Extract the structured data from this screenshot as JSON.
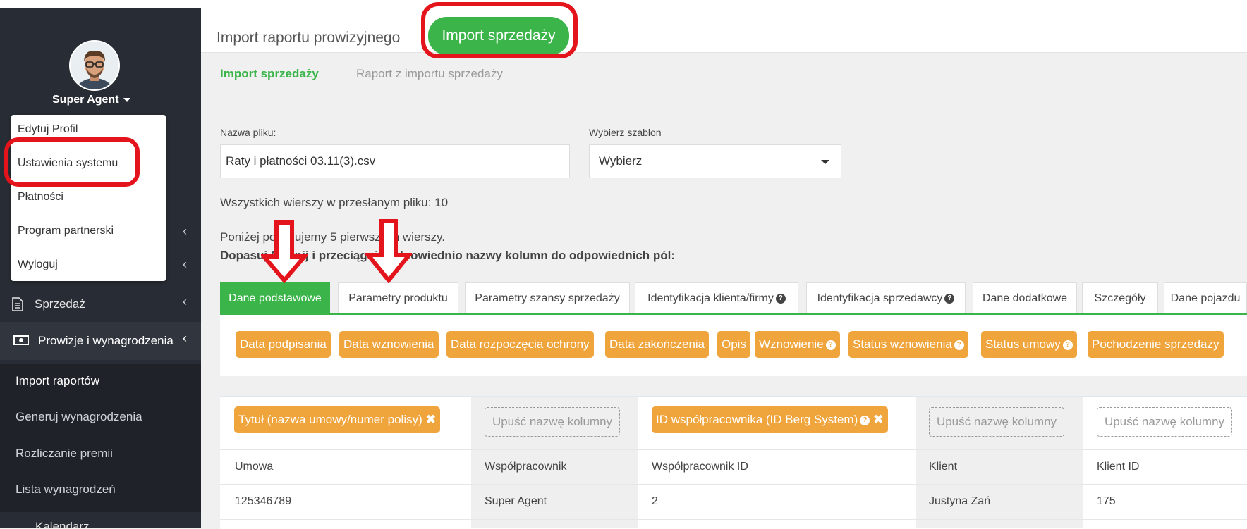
{
  "sidebar": {
    "user": {
      "name": "Super Agent"
    },
    "dropdown": [
      "Edytuj Profil",
      "Ustawienia systemu",
      "Płatności",
      "Program partnerski",
      "Wyloguj"
    ],
    "items": {
      "sales": "Sprzedaż",
      "commissions": "Prowizje i wynagrodzenia"
    },
    "submenu": [
      "Import raportów",
      "Generuj wynagrodzenia",
      "Rozliczanie premii",
      "Lista wynagrodzeń"
    ],
    "cut_item": "Kalendarz"
  },
  "topbar": {
    "tabs": [
      "Import raportu prowizyjnego",
      "Import sprzedaży"
    ]
  },
  "subtabs": [
    "Import sprzedaży",
    "Raport z importu sprzedaży"
  ],
  "form": {
    "file_label": "Nazwa pliku:",
    "file_value": "Raty i płatności 03.11(3).csv",
    "template_label": "Wybierz szablon",
    "template_value": "Wybierz"
  },
  "info": {
    "rows_total": "Wszystkich wierszy w przesłanym pliku: 10",
    "preview": "Poniżej pokazujemy 5 pierwszych wierszy.",
    "instruction": "Dopasuj (kliknij i przeciągnij) odpowiednio nazwy kolumn do odpowiednich pól:"
  },
  "field_tabs": [
    "Dane podstawowe",
    "Parametry produktu",
    "Parametry szansy sprzedaży",
    "Identyfikacja klienta/firmy",
    "Identyfikacja sprzedawcy",
    "Dane dodatkowe",
    "Szczegóły",
    "Dane pojazdu"
  ],
  "chips": [
    "Data podpisania",
    "Data wznowienia",
    "Data rozpoczęcia ochrony",
    "Data zakończenia",
    "Opis",
    "Wznowienie",
    "Status wznowienia",
    "Status umowy",
    "Pochodzenie sprzedaży"
  ],
  "mapping": {
    "assigned": [
      "Tytuł (nazwa umowy/numer polisy)",
      "ID współpracownika (ID Berg System)"
    ],
    "drop_placeholder": "Upuść nazwę kolumny",
    "headers": [
      "Umowa",
      "Współpracownik",
      "Współpracownik ID",
      "Klient",
      "Klient ID"
    ],
    "row": [
      "125346789",
      "Super Agent",
      "2",
      "Justyna Zań",
      "175"
    ]
  },
  "colors": {
    "accent": "#3bb54a",
    "chip": "#f0a43c",
    "highlight": "#e3141b",
    "sidebar": "#282c34"
  }
}
